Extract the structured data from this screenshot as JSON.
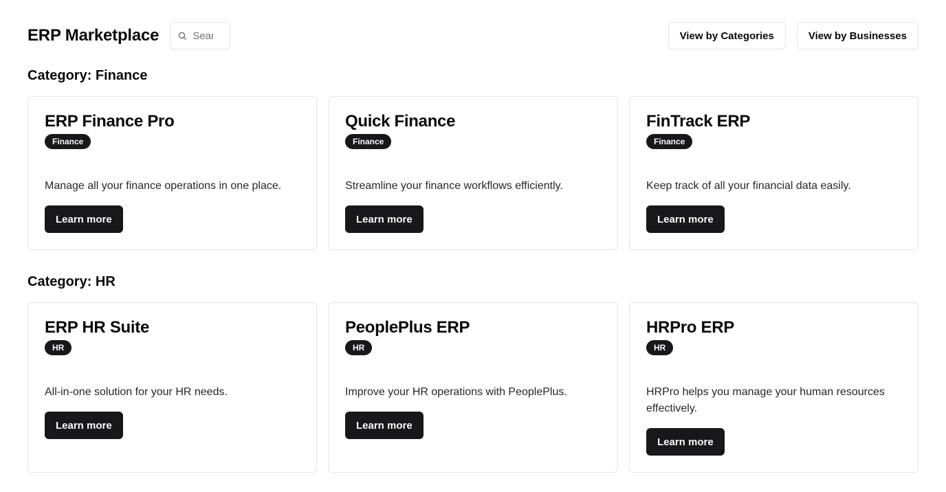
{
  "header": {
    "title": "ERP Marketplace",
    "search_placeholder": "Search",
    "search_icon": "search-icon",
    "view_by_categories_label": "View by Categories",
    "view_by_businesses_label": "View by Businesses"
  },
  "categories": [
    {
      "heading": "Category: Finance",
      "cards": [
        {
          "title": "ERP Finance Pro",
          "badge": "Finance",
          "description": "Manage all your finance operations in one place.",
          "button_label": "Learn more"
        },
        {
          "title": "Quick Finance",
          "badge": "Finance",
          "description": "Streamline your finance workflows efficiently.",
          "button_label": "Learn more"
        },
        {
          "title": "FinTrack ERP",
          "badge": "Finance",
          "description": "Keep track of all your financial data easily.",
          "button_label": "Learn more"
        }
      ]
    },
    {
      "heading": "Category: HR",
      "cards": [
        {
          "title": "ERP HR Suite",
          "badge": "HR",
          "description": "All-in-one solution for your HR needs.",
          "button_label": "Learn more"
        },
        {
          "title": "PeoplePlus ERP",
          "badge": "HR",
          "description": "Improve your HR operations with PeoplePlus.",
          "button_label": "Learn more"
        },
        {
          "title": "HRPro ERP",
          "badge": "HR",
          "description": "HRPro helps you manage your human resources effectively.",
          "button_label": "Learn more"
        }
      ]
    }
  ],
  "colors": {
    "primary": "#18181b",
    "border": "#e4e4e7",
    "background": "#ffffff",
    "muted_text": "#71717a"
  }
}
